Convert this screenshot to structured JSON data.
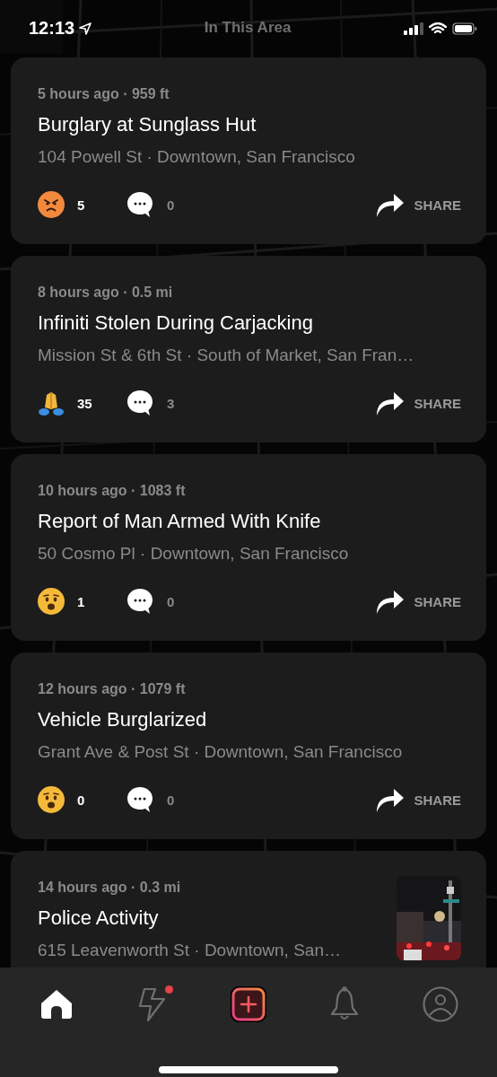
{
  "status_bar": {
    "time": "12:13"
  },
  "header": {
    "title": "In This Area"
  },
  "incidents": [
    {
      "meta": "5 hours ago · 959 ft",
      "title": "Burglary at Sunglass Hut",
      "address": "104 Powell St · Downtown, San Francisco",
      "reaction": {
        "kind": "angry",
        "count": "5"
      },
      "comments": "0",
      "share": "SHARE"
    },
    {
      "meta": "8 hours ago · 0.5 mi",
      "title": "Infiniti Stolen During Carjacking",
      "address": "Mission St & 6th St · South of Market, San Fran…",
      "reaction": {
        "kind": "pray",
        "count": "35"
      },
      "comments": "3",
      "share": "SHARE"
    },
    {
      "meta": "10 hours ago · 1083 ft",
      "title": "Report of Man Armed With Knife",
      "address": "50 Cosmo Pl · Downtown, San Francisco",
      "reaction": {
        "kind": "shocked",
        "count": "1"
      },
      "comments": "0",
      "share": "SHARE"
    },
    {
      "meta": "12 hours ago · 1079 ft",
      "title": "Vehicle Burglarized",
      "address": "Grant Ave & Post St · Downtown, San Francisco",
      "reaction": {
        "kind": "shocked",
        "count": "0"
      },
      "comments": "0",
      "share": "SHARE"
    },
    {
      "meta": "14 hours ago · 0.3 mi",
      "title": "Police Activity",
      "address": "615 Leavenworth St · Downtown, San…"
    }
  ],
  "tab_bar": [
    {
      "kind": "home",
      "selected": true,
      "badge": false
    },
    {
      "kind": "bolt",
      "selected": false,
      "badge": true
    },
    {
      "kind": "add",
      "selected": false,
      "badge": false
    },
    {
      "kind": "bell",
      "selected": false,
      "badge": false
    },
    {
      "kind": "profile",
      "selected": false,
      "badge": false
    }
  ]
}
